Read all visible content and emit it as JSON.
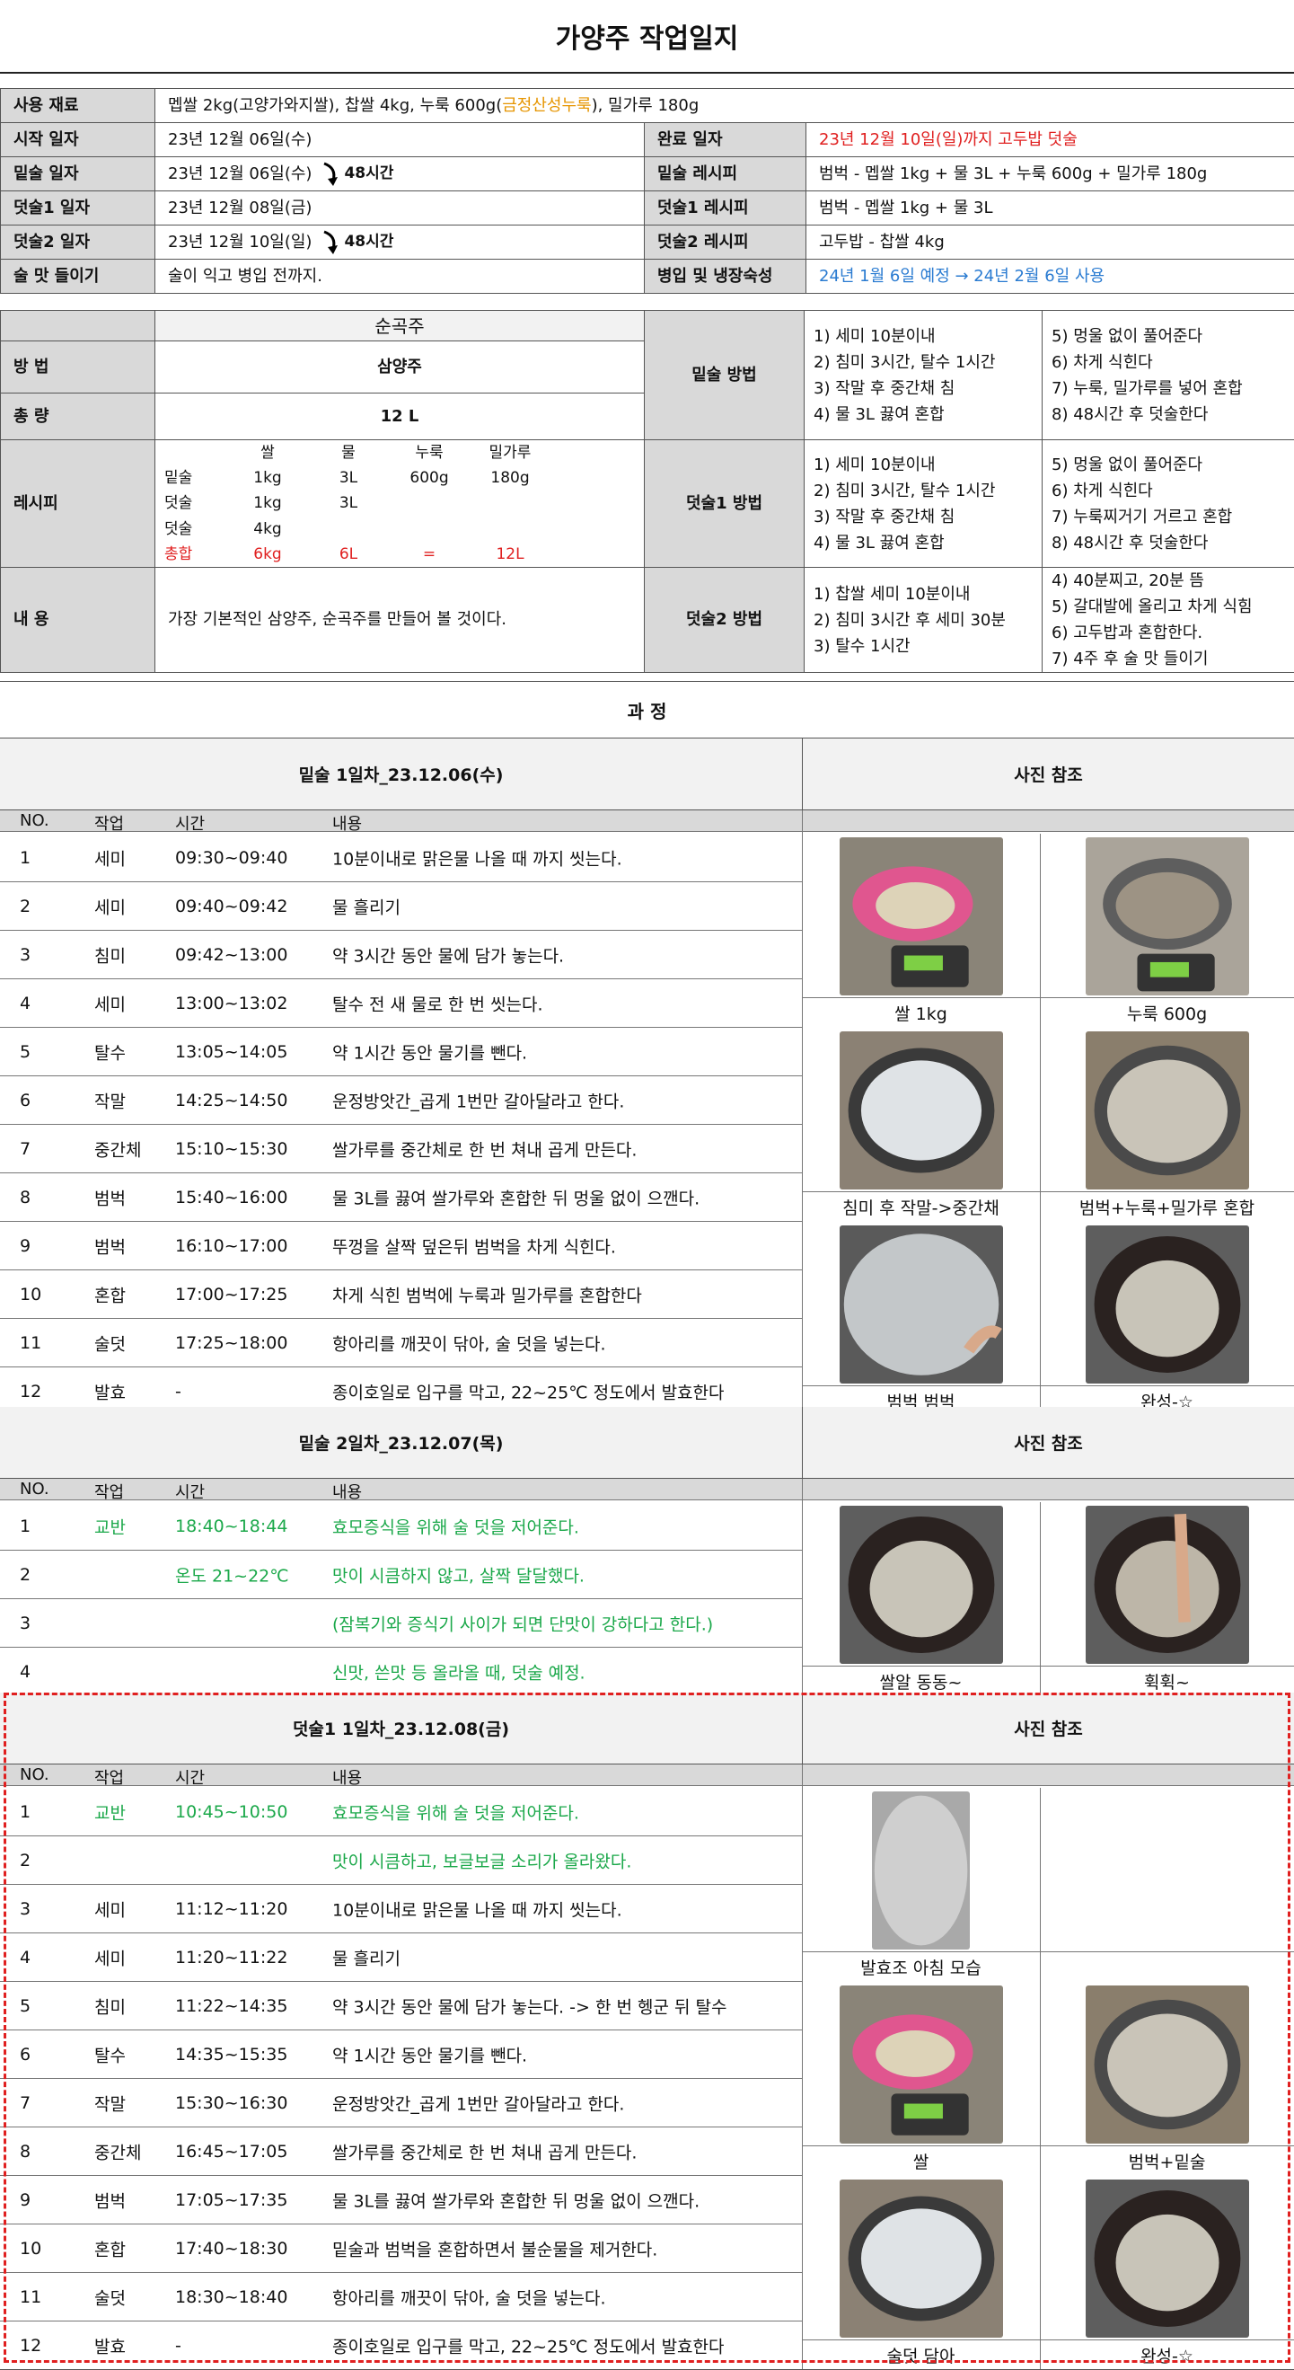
{
  "title": "가양주 작업일지",
  "info": {
    "materials_label": "사용 재료",
    "materials_a": "멥쌀 2kg(고양가와지쌀), 찹쌀 4kg, 누룩 600g(",
    "materials_b": "금정산성누룩",
    "materials_c": "), 밀가루 180g",
    "start_label": "시작 일자",
    "start_value": "23년 12월 06일(수)",
    "mit_label": "밑술 일자",
    "mit_value": "23년 12월 06일(수)",
    "d1_label": "덧술1 일자",
    "d1_value": "23년 12월 08일(금)",
    "d2_label": "덧술2 일자",
    "d2_value": "23년 12월 10일(일)",
    "taste_label": "술 맛 들이기",
    "taste_value": "술이 익고 병입 전까지.",
    "gap1": "48시간",
    "gap2": "48시간",
    "done_label": "완료 일자",
    "done_value": "23년 12월 10일(일)까지 고두밥 덧술",
    "mit_recipe_label": "밑술 레시피",
    "mit_recipe_value": "범벅 - 멥쌀 1kg + 물 3L + 누룩 600g + 밀가루 180g",
    "d1_recipe_label": "덧술1 레시피",
    "d1_recipe_value": "범벅 - 멥쌀 1kg + 물 3L",
    "d2_recipe_label": "덧술2 레시피",
    "d2_recipe_value": "고두밥 - 찹쌀 4kg",
    "bottle_label": "병입 및 냉장숙성",
    "bottle_value": "24년 1월 6일 예정 → 24년 2월 6일 사용"
  },
  "method": {
    "type_name": "순곡주",
    "method_label": "방 법",
    "method_value": "삼양주",
    "total_label": "총 량",
    "total_value": "12 L",
    "recipe_label": "레시피",
    "recipe_headers": [
      "",
      "쌀",
      "물",
      "누룩",
      "밀가루"
    ],
    "recipe_rows": [
      [
        "밑술",
        "1kg",
        "3L",
        "600g",
        "180g"
      ],
      [
        "덧술",
        "1kg",
        "3L",
        "",
        ""
      ],
      [
        "덧술",
        "4kg",
        "",
        "",
        ""
      ]
    ],
    "recipe_total": [
      "총합",
      "6kg",
      "6L",
      "=",
      "12L"
    ],
    "content_label": "내 용",
    "content_value": "가장 기본적인 삼양주, 순곡주를 만들어 볼 것이다.",
    "mit_method_label": "밑술 방법",
    "mit_steps_a": [
      "1) 세미 10분이내",
      "2) 침미 3시간, 탈수 1시간",
      "3) 작말 후 중간채 침",
      "4) 물 3L 끓여 혼합"
    ],
    "mit_steps_b": [
      "5) 멍울 없이 풀어준다",
      "6) 차게 식힌다",
      "7) 누룩, 밀가루를 넣어 혼합",
      "8) 48시간 후 덧술한다"
    ],
    "d1_method_label": "덧술1 방법",
    "d1_steps_a": [
      "1) 세미 10분이내",
      "2) 침미 3시간, 탈수 1시간",
      "3) 작말 후 중간채 침",
      "4) 물 3L 끓여 혼합"
    ],
    "d1_steps_b": [
      "5) 멍울 없이 풀어준다",
      "6) 차게 식힌다",
      "7) 누룩찌거기 거르고 혼합",
      "8) 48시간 후 덧술한다"
    ],
    "d2_method_label": "덧술2 방법",
    "d2_steps_a": [
      "1) 찹쌀 세미 10분이내",
      "2) 침미 3시간 후 세미 30분",
      "3) 탈수 1시간"
    ],
    "d2_steps_b": [
      "4) 40분찌고, 20분 뜸",
      "5) 갈대발에 올리고 차게 식힘",
      "6) 고두밥과 혼합한다.",
      "7) 4주 후 술 맛 들이기"
    ]
  },
  "process": {
    "title": "과 정",
    "photo_ref": "사진 참조",
    "col_headers": [
      "NO.",
      "작업",
      "시간",
      "내용"
    ],
    "day1": {
      "title": "밑술 1일차_23.12.06(수)",
      "rows": [
        [
          "1",
          "세미",
          "09:30~09:40",
          "10분이내로 맑은물 나올 때 까지 씻는다."
        ],
        [
          "2",
          "세미",
          "09:40~09:42",
          "물 흘리기"
        ],
        [
          "3",
          "침미",
          "09:42~13:00",
          "약 3시간 동안 물에 담가 놓는다."
        ],
        [
          "4",
          "세미",
          "13:00~13:02",
          "탈수 전 새 물로 한 번 씻는다."
        ],
        [
          "5",
          "탈수",
          "13:05~14:05",
          "약 1시간 동안 물기를 뺀다."
        ],
        [
          "6",
          "작말",
          "14:25~14:50",
          "운정방앗간_곱게 1번만 갈아달라고 한다."
        ],
        [
          "7",
          "중간체",
          "15:10~15:30",
          "쌀가루를 중간체로 한 번 쳐내 곱게 만든다."
        ],
        [
          "8",
          "범벅",
          "15:40~16:00",
          "물 3L를 끓여 쌀가루와 혼합한 뒤 멍울 없이 으깬다."
        ],
        [
          "9",
          "범벅",
          "16:10~17:00",
          "뚜껑을 살짝 덮은뒤 범벅을 차게 식힌다."
        ],
        [
          "10",
          "혼합",
          "17:00~17:25",
          "차게 식힌 범벅에 누룩과 밀가루를 혼합한다"
        ],
        [
          "11",
          "술덧",
          "17:25~18:00",
          "항아리를 깨끗이 닦아, 술 덧을 넣는다."
        ],
        [
          "12",
          "발효",
          "-",
          "종이호일로 입구를 막고, 22~25℃ 정도에서 발효한다"
        ]
      ],
      "captions": [
        "쌀 1kg",
        "누룩 600g",
        "침미 후 작말->중간채",
        "범벅+누룩+밀가루 혼합",
        "범벅 범벅",
        "완성-☆"
      ]
    },
    "day2": {
      "title": "밑술 2일차_23.12.07(목)",
      "rows": [
        [
          "1",
          "교반",
          "18:40~18:44",
          "효모증식을 위해 술 덧을 저어준다."
        ],
        [
          "2",
          "",
          "온도 21~22℃",
          "맛이 시큼하지 않고, 살짝 달달했다."
        ],
        [
          "3",
          "",
          "",
          "(잠복기와 증식기 사이가 되면 단맛이 강하다고 한다.)"
        ],
        [
          "4",
          "",
          "",
          "신맛, 쓴맛 등 올라올 때, 덧술 예정."
        ]
      ],
      "captions": [
        "쌀알 동동~",
        "휙휙~"
      ]
    },
    "day3": {
      "title": "덧술1 1일차_23.12.08(금)",
      "rows": [
        [
          "1",
          "교반",
          "10:45~10:50",
          "효모증식을 위해 술 덧을 저어준다."
        ],
        [
          "2",
          "",
          "",
          "맛이 시큼하고, 보글보글 소리가 올라왔다."
        ],
        [
          "3",
          "세미",
          "11:12~11:20",
          "10분이내로 맑은물 나올 때 까지 씻는다."
        ],
        [
          "4",
          "세미",
          "11:20~11:22",
          "물 흘리기"
        ],
        [
          "5",
          "침미",
          "11:22~14:35",
          "약 3시간 동안 물에 담가 놓는다. -> 한 번 헹군 뒤 탈수"
        ],
        [
          "6",
          "탈수",
          "14:35~15:35",
          "약 1시간 동안 물기를 뺀다."
        ],
        [
          "7",
          "작말",
          "15:30~16:30",
          "운정방앗간_곱게 1번만 갈아달라고 한다."
        ],
        [
          "8",
          "중간체",
          "16:45~17:05",
          "쌀가루를 중간체로 한 번 쳐내 곱게 만든다."
        ],
        [
          "9",
          "범벅",
          "17:05~17:35",
          "물 3L를 끓여 쌀가루와 혼합한 뒤 멍울 없이 으깬다."
        ],
        [
          "10",
          "혼합",
          "17:40~18:30",
          "밑술과 범벅을 혼합하면서 불순물을 제거한다."
        ],
        [
          "11",
          "술덧",
          "18:30~18:40",
          "항아리를 깨끗이 닦아, 술 덧을 넣는다."
        ],
        [
          "12",
          "발효",
          "-",
          "종이호일로 입구를 막고, 22~25℃ 정도에서 발효한다"
        ]
      ],
      "captions": [
        "발효조 아침 모습",
        "",
        "쌀",
        "범벅+밑술",
        "술덧 담아",
        "완성-☆"
      ]
    }
  },
  "colors": {
    "label_bg": "#d9d9d9",
    "red": "#e02020",
    "blue": "#2a7bd1",
    "green": "#1ba84a",
    "orange": "#e69500",
    "highlight_border": "#e02020"
  }
}
